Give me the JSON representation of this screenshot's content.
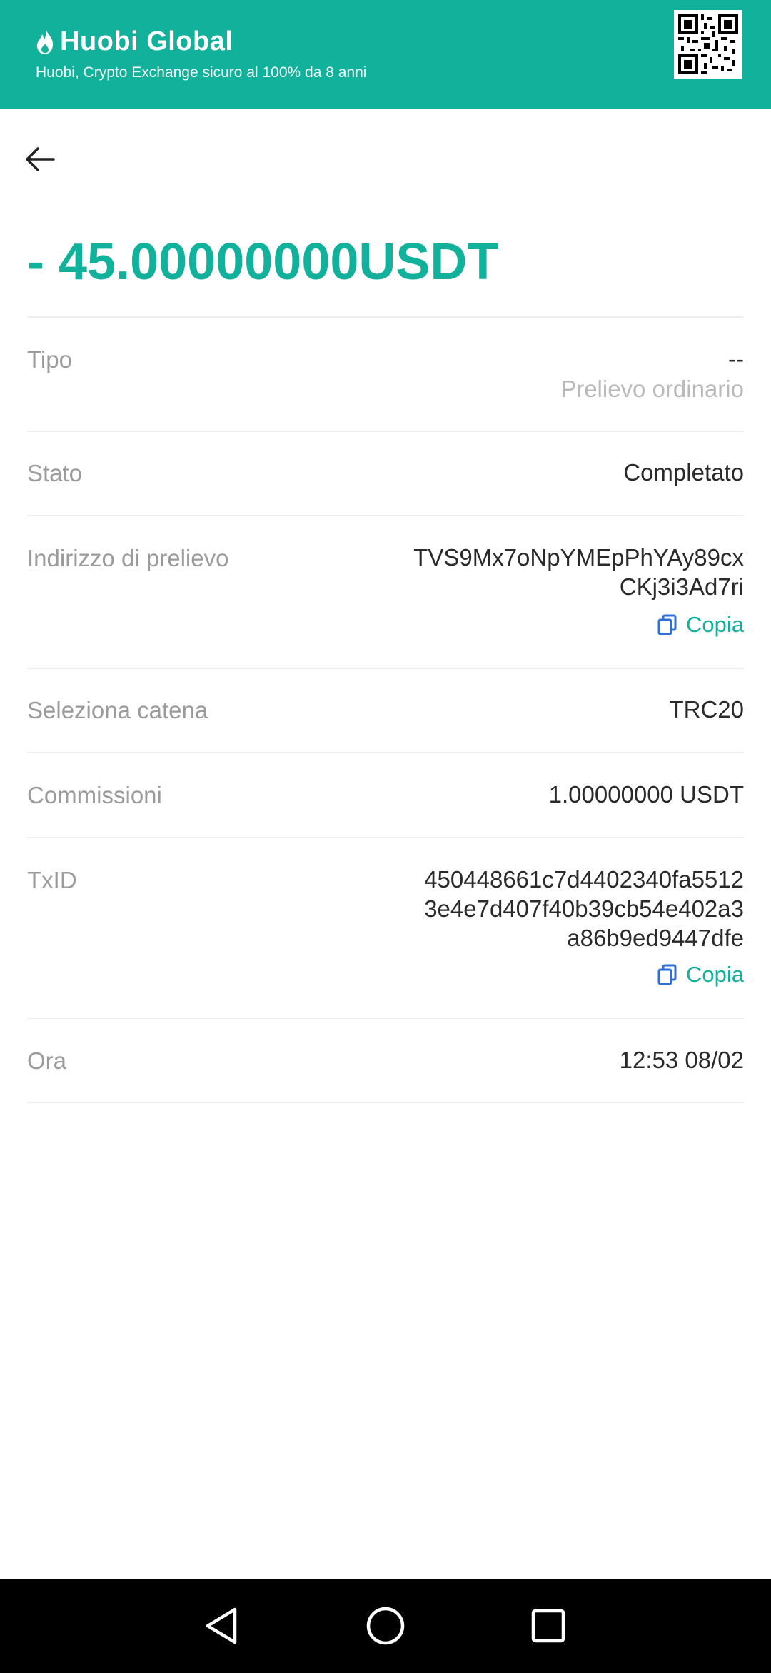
{
  "banner": {
    "brand_name": "Huobi Global",
    "tagline": "Huobi, Crypto Exchange sicuro al 100% da 8 anni"
  },
  "colors": {
    "accent": "#12b19b",
    "banner_bg": "#12b19b",
    "label": "#9b9b9b",
    "value": "#2a2a2a",
    "divider": "#eeeeee",
    "copy_icon": "#2f6fd6"
  },
  "icons": {
    "back": "arrow-left-icon",
    "copy": "copy-icon",
    "logo": "flame-logo-icon",
    "qr": "qr-code"
  },
  "amount": "- 45.00000000USDT",
  "details": {
    "tipo": {
      "label": "Tipo",
      "value": "--",
      "sub": "Prelievo ordinario"
    },
    "stato": {
      "label": "Stato",
      "value": "Completato"
    },
    "indirizzo": {
      "label": "Indirizzo di prelievo",
      "value_line1": "TVS9Mx7oNpYMEpPhYAy89cx",
      "value_line2": "CKj3i3Ad7ri",
      "copy_label": "Copia"
    },
    "catena": {
      "label": "Seleziona catena",
      "value": "TRC20"
    },
    "commissioni": {
      "label": "Commissioni",
      "value": "1.00000000 USDT"
    },
    "txid": {
      "label": "TxID",
      "value_line1": "450448661c7d4402340fa5512",
      "value_line2": "3e4e7d407f40b39cb54e402a3",
      "value_line3": "a86b9ed9447dfe",
      "copy_label": "Copia"
    },
    "ora": {
      "label": "Ora",
      "value": "12:53 08/02"
    }
  }
}
